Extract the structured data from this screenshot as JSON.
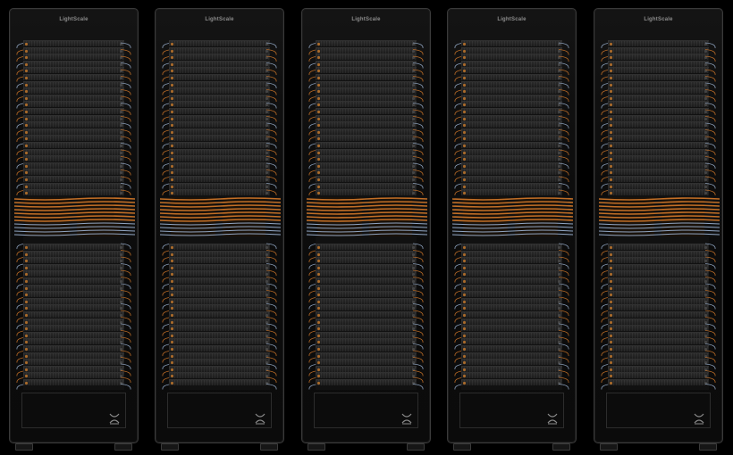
{
  "scene": {
    "background": "#000000",
    "cable_colors": {
      "orange": "#d67a2a",
      "blue": "#9fb6d6",
      "gray": "#7a7a7a"
    }
  },
  "racks": [
    {
      "brand": "LightScale"
    },
    {
      "brand": "LightScale"
    },
    {
      "brand": "LightScale"
    },
    {
      "brand": "LightScale"
    },
    {
      "brand": "LightScale"
    }
  ]
}
